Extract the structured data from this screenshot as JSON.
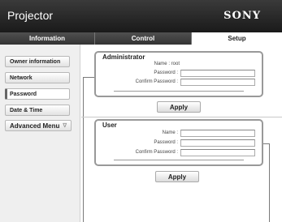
{
  "header": {
    "title": "Projector",
    "brand": "SONY"
  },
  "tabs": [
    {
      "label": "Information",
      "active": false
    },
    {
      "label": "Control",
      "active": false
    },
    {
      "label": "Setup",
      "active": true
    }
  ],
  "sidebar": {
    "items": [
      {
        "label": "Owner information"
      },
      {
        "label": "Network"
      },
      {
        "label": "Password",
        "active": true
      },
      {
        "label": "Date & Time"
      },
      {
        "label": "Advanced Menu"
      }
    ]
  },
  "administrator": {
    "title": "Administrator",
    "name_label": "Name : root",
    "password_label": "Password :",
    "confirm_label": "Confirm Password :",
    "password_value": "",
    "confirm_value": "",
    "apply_label": "Apply"
  },
  "user": {
    "title": "User",
    "name_label": "Name :",
    "password_label": "Password :",
    "confirm_label": "Confirm Password :",
    "name_value": "",
    "password_value": "",
    "confirm_value": "",
    "apply_label": "Apply"
  }
}
